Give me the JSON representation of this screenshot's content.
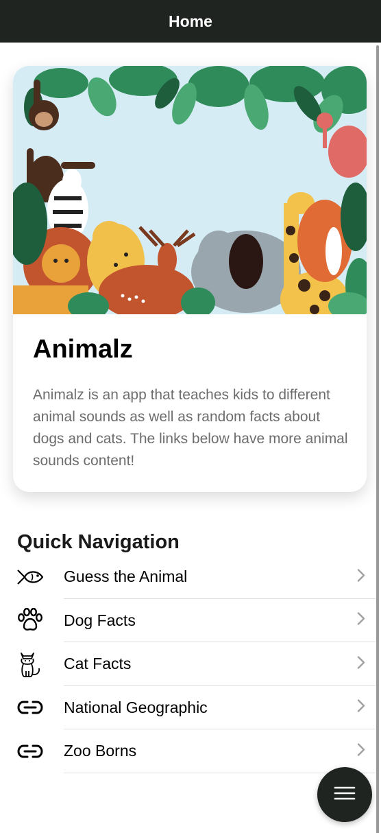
{
  "header": {
    "title": "Home"
  },
  "card": {
    "title": "Animalz",
    "description": "Animalz is an app that teaches kids to different animal sounds as well as random facts about dogs and cats. The links below have more animal sounds content!"
  },
  "quick_nav": {
    "title": "Quick Navigation",
    "items": [
      {
        "label": "Guess the Animal",
        "icon": "fish-icon"
      },
      {
        "label": "Dog Facts",
        "icon": "paw-icon"
      },
      {
        "label": "Cat Facts",
        "icon": "cat-icon"
      },
      {
        "label": "National Geographic",
        "icon": "link-icon"
      },
      {
        "label": "Zoo Borns",
        "icon": "link-icon"
      }
    ]
  },
  "fab": {
    "icon": "menu-icon"
  },
  "colors": {
    "header_bg": "#1f2421",
    "fab_bg": "#1f2421",
    "hero_sky": "#d6ecf5",
    "body_text": "#6d6d6d"
  }
}
